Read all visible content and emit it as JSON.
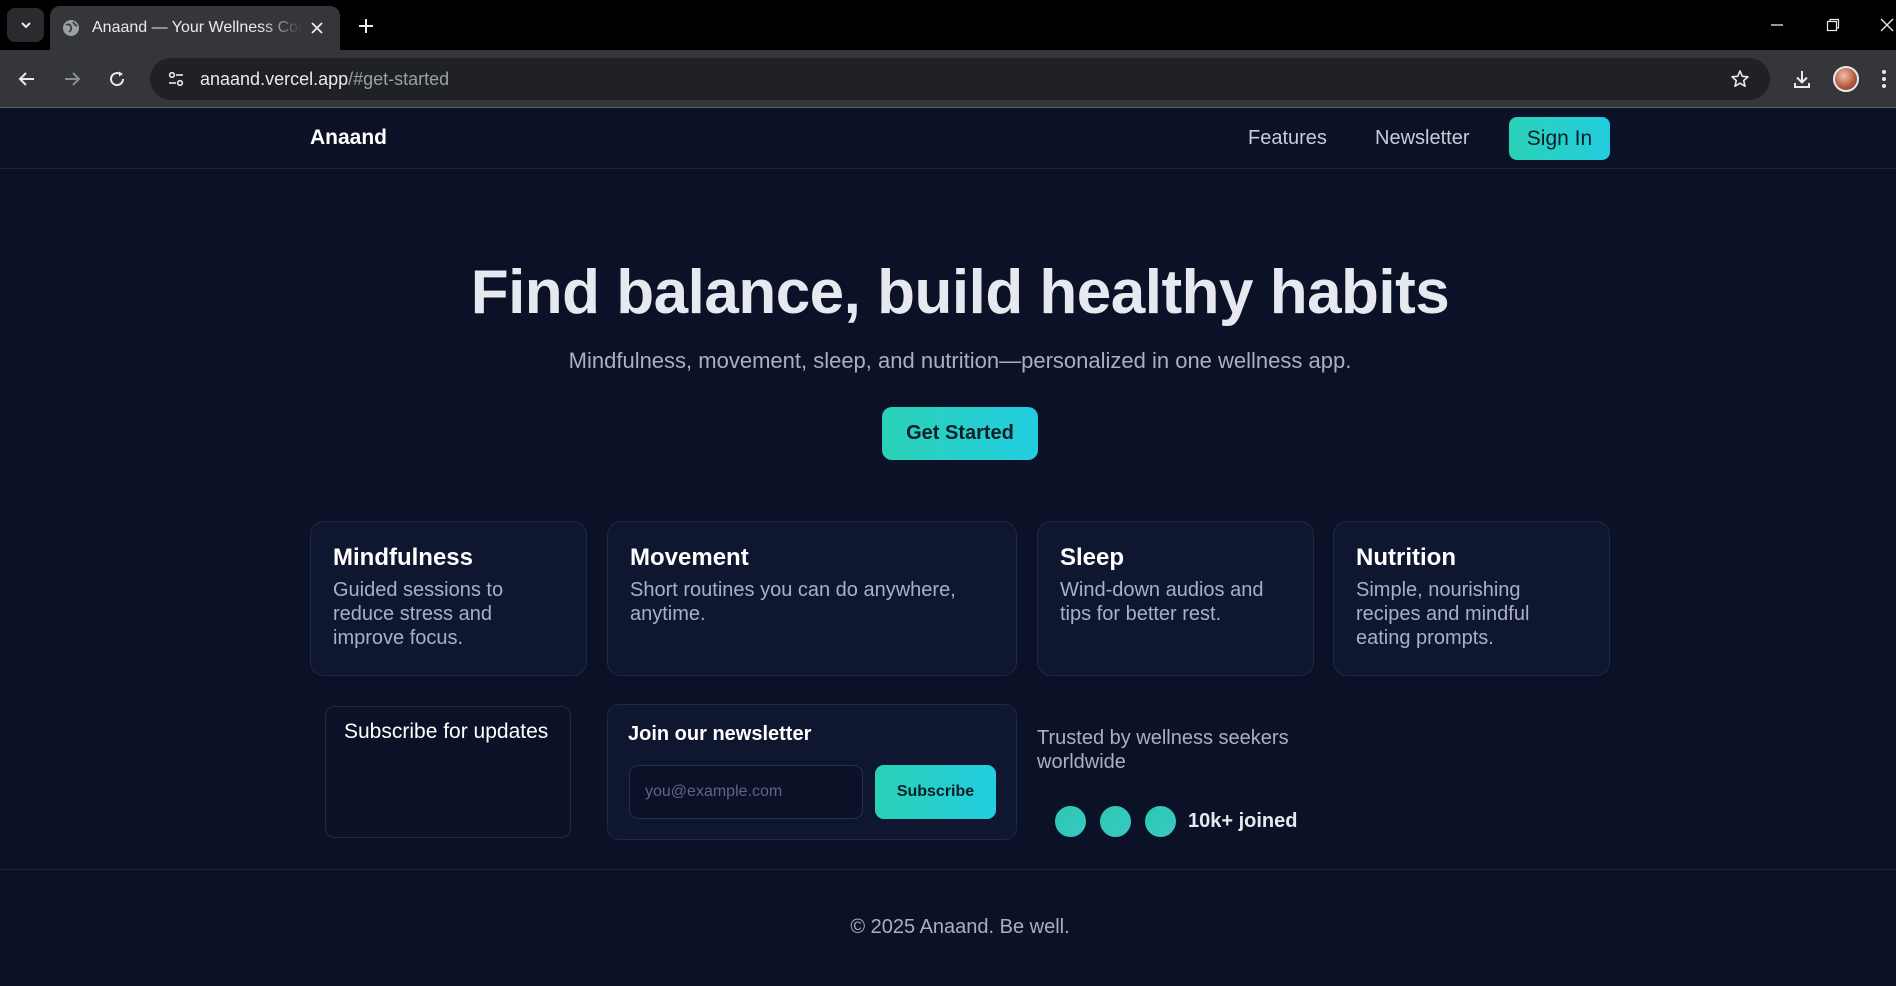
{
  "browser": {
    "tab_title": "Anaand — Your Wellness Companion",
    "url_host": "anaand.vercel.app",
    "url_path": "/#get-started"
  },
  "site": {
    "brand": "Anaand",
    "nav": [
      "Features",
      "Newsletter"
    ],
    "signin_label": "Sign In"
  },
  "hero": {
    "title": "Find balance, build healthy habits",
    "subtitle": "Mindfulness, movement, sleep, and nutrition—personalized in one wellness app.",
    "cta_label": "Get Started"
  },
  "features": [
    {
      "title": "Mindfulness",
      "text": "Guided sessions to reduce stress and improve focus."
    },
    {
      "title": "Movement",
      "text": "Short routines you can do anywhere, anytime."
    },
    {
      "title": "Sleep",
      "text": "Wind-down audios and tips for better rest."
    },
    {
      "title": "Nutrition",
      "text": "Simple, nourishing recipes and mindful eating prompts."
    }
  ],
  "subscribe_box": {
    "title": "Subscribe for updates"
  },
  "newsletter": {
    "title": "Join our newsletter",
    "email_placeholder": "you@example.com",
    "button_label": "Subscribe"
  },
  "social_proof": {
    "text": "Trusted by wellness seekers worldwide",
    "joined": "10k+ joined"
  },
  "footer": {
    "copyright": "© 2025 Anaand. Be well."
  },
  "colors": {
    "background": "#0b1228",
    "accent_start": "#2bd1b6",
    "accent_end": "#22cde0"
  }
}
